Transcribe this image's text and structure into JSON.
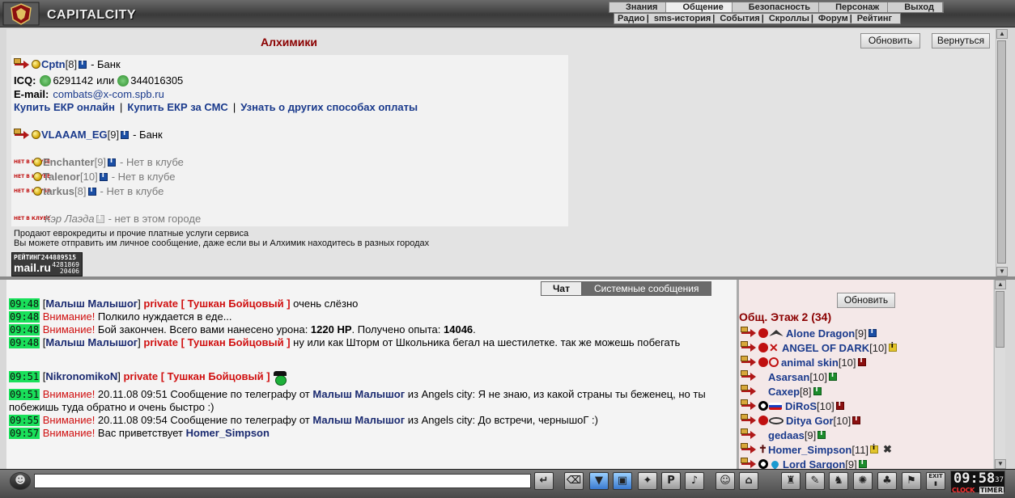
{
  "app": {
    "brand": "CAPITALCITY"
  },
  "menu_top": [
    "Знания",
    "Общение",
    "Безопасность",
    "Персонаж",
    "Выход"
  ],
  "menu_top_active": 1,
  "menu_sub": [
    "Радио",
    "sms-история",
    "События",
    "Скроллы",
    "Форум",
    "Рейтинг"
  ],
  "upper": {
    "title": "Алхимики",
    "refresh_label": "Обновить",
    "back_label": "Вернуться",
    "alchemists": [
      {
        "nick": "Cptn",
        "level": "[8]",
        "status": "- Банк"
      },
      {
        "nick": "VLAAAM_EG",
        "level": "[9]",
        "status": "- Банк"
      },
      {
        "nick": "Enchanter",
        "level": "[9]",
        "status": "- Нет в клубе"
      },
      {
        "nick": "Talenor",
        "level": "[10]",
        "status": "- Нет в клубе"
      },
      {
        "nick": "tarkus",
        "level": "[8]",
        "status": "- Нет в клубе"
      },
      {
        "nick": "Кэр Лаэда",
        "level": "",
        "status": "- нет в этом городе"
      }
    ],
    "icq_label": "ICQ:",
    "icq1": "6291142",
    "icq_or": "или",
    "icq2": "344016305",
    "email_label": "E-mail:",
    "email": "combats@x-com.spb.ru",
    "pay_links": [
      "Купить ЕКР онлайн",
      "Купить ЕКР за СМС",
      "Узнать о других способах оплаты"
    ],
    "notin_label": "НЕТ В КЛУБЕ",
    "note1": "Продают еврокредиты и прочие платные услуги сервиса",
    "note2": "Вы можете отправить им личное сообщение, даже если вы и Алхимик находитесь в разных городах",
    "rating": {
      "label": "РЕЙТИНГ",
      "v1": "244889515",
      "brand": "mail.ru",
      "v2": "4281869",
      "v3": "20406"
    }
  },
  "chat": {
    "tabs": [
      "Чат",
      "Системные сообщения"
    ],
    "lines": [
      {
        "time": "09:48",
        "parts": [
          [
            "t",
            "["
          ],
          [
            "who",
            "Малыш Малышог"
          ],
          [
            "t",
            "] "
          ],
          [
            "priv",
            "private [ Тушкан Бойцовый ]"
          ],
          [
            "t",
            " очень слёзно"
          ]
        ]
      },
      {
        "time": "09:48",
        "parts": [
          [
            "warn",
            "Внимание!"
          ],
          [
            "t",
            " Полкило нуждается в еде..."
          ]
        ]
      },
      {
        "time": "09:48",
        "parts": [
          [
            "warn",
            "Внимание!"
          ],
          [
            "t",
            " Бой закончен. Всего вами нанесено урона: "
          ],
          [
            "b",
            "1220 HP"
          ],
          [
            "t",
            ". Получено опыта: "
          ],
          [
            "b",
            "14046"
          ],
          [
            "t",
            "."
          ]
        ]
      },
      {
        "time": "09:48",
        "parts": [
          [
            "t",
            "["
          ],
          [
            "who",
            "Малыш Малышог"
          ],
          [
            "t",
            "] "
          ],
          [
            "priv",
            "private [ Тушкан Бойцовый ]"
          ],
          [
            "t",
            " ну или как Шторм от Школьника бегал на шестилетке. так же можешь побегать"
          ]
        ]
      },
      {
        "time": "09:51",
        "parts": [
          [
            "t",
            "["
          ],
          [
            "who",
            "NikronomikoN"
          ],
          [
            "t",
            "] "
          ],
          [
            "priv",
            "private [ Тушкан Бойцовый ]"
          ],
          [
            "smiley",
            ""
          ]
        ]
      },
      {
        "time": "09:51",
        "parts": [
          [
            "warn",
            "Внимание!"
          ],
          [
            "t",
            " 20.11.08 09:51 Сообщение по телеграфу от "
          ],
          [
            "who",
            "Малыш Малышог"
          ],
          [
            "t",
            " из Angels city: Я не знаю, из какой страны ты беженец, но ты побежишь туда обратно и очень быстро :)"
          ]
        ]
      },
      {
        "time": "09:55",
        "parts": [
          [
            "warn",
            "Внимание!"
          ],
          [
            "t",
            " 20.11.08 09:54 Сообщение по телеграфу от "
          ],
          [
            "who",
            "Малыш Малышог"
          ],
          [
            "t",
            " из Angels city: До встречи, чернышоГ :)"
          ]
        ]
      },
      {
        "time": "09:57",
        "parts": [
          [
            "warn",
            "Внимание!"
          ],
          [
            "t",
            " Вас приветствует "
          ],
          [
            "who",
            "Homer_Simpson"
          ]
        ]
      }
    ]
  },
  "users": {
    "refresh_label": "Обновить",
    "room_title": "Общ. Этаж 2 (34)",
    "list": [
      {
        "nick": "Alone Dragon",
        "level": "[9]",
        "icons": [
          "red",
          "bird"
        ],
        "info": "blue"
      },
      {
        "nick": "ANGEL OF DARK",
        "level": "[10]",
        "icons": [
          "red",
          "x"
        ],
        "info": "yel"
      },
      {
        "nick": "animal skin",
        "level": "[10]",
        "icons": [
          "red",
          "ring"
        ],
        "info": "red"
      },
      {
        "nick": "Asarsan",
        "level": "[10]",
        "icons": [],
        "info": "green"
      },
      {
        "nick": "Caxep",
        "level": "[8]",
        "icons": [],
        "info": "green"
      },
      {
        "nick": "DiRoS",
        "level": "[10]",
        "icons": [
          "yy",
          "flag"
        ],
        "info": "red"
      },
      {
        "nick": "Ditya Gor",
        "level": "[10]",
        "icons": [
          "red",
          "eye"
        ],
        "info": "red"
      },
      {
        "nick": "gedaas",
        "level": "[9]",
        "icons": [],
        "info": "green"
      },
      {
        "nick": "Homer_Simpson",
        "level": "[11]",
        "icons": [
          "cross"
        ],
        "info": "yel",
        "extra": "✖"
      },
      {
        "nick": "Lord Sargon",
        "level": "[9]",
        "icons": [
          "yy",
          "drop"
        ],
        "info": "green"
      }
    ]
  },
  "clock": {
    "time": "09:58",
    "sec": "37",
    "label1": "CLOCK",
    "label2": "TIMER"
  },
  "toolbar": {
    "exit": "EXIT"
  }
}
